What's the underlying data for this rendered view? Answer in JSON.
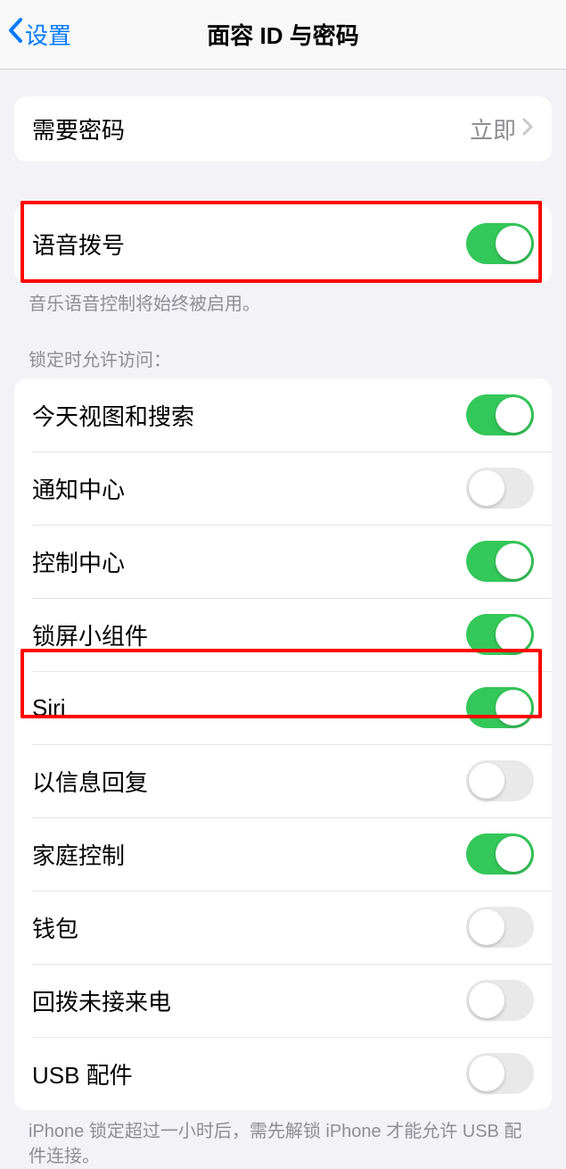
{
  "header": {
    "back_label": "设置",
    "title": "面容 ID 与密码"
  },
  "require_passcode": {
    "label": "需要密码",
    "value": "立即"
  },
  "voice_dial": {
    "label": "语音拨号",
    "footer": "音乐语音控制将始终被启用。",
    "on": true
  },
  "lock_access_header": "锁定时允许访问：",
  "lock_access": [
    {
      "label": "今天视图和搜索",
      "on": true
    },
    {
      "label": "通知中心",
      "on": false
    },
    {
      "label": "控制中心",
      "on": true
    },
    {
      "label": "锁屏小组件",
      "on": true
    },
    {
      "label": "Siri",
      "on": true
    },
    {
      "label": "以信息回复",
      "on": false
    },
    {
      "label": "家庭控制",
      "on": true
    },
    {
      "label": "钱包",
      "on": false
    },
    {
      "label": "回拨未接来电",
      "on": false
    },
    {
      "label": "USB 配件",
      "on": false
    }
  ],
  "usb_footer": "iPhone 锁定超过一小时后，需先解锁 iPhone 才能允许 USB 配件连接。"
}
